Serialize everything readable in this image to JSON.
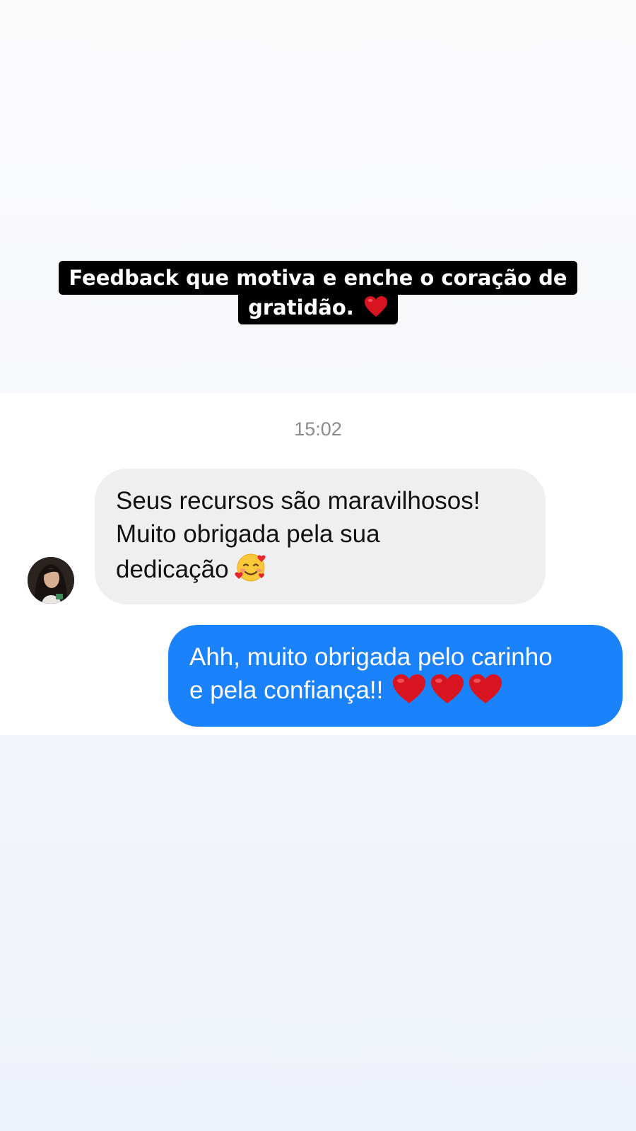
{
  "story": {
    "caption_line1": "Feedback que motiva e enche o coração de",
    "caption_line2": "gratidão.",
    "caption_emoji": "red-heart"
  },
  "chat": {
    "timestamp": "15:02",
    "incoming": {
      "line1": "Seus recursos são maravilhosos!",
      "line2": "Muito obrigada pela sua",
      "line3": "dedicação",
      "emoji": "smiling-face-with-hearts"
    },
    "outgoing": {
      "line1": "Ahh, muito obrigada pelo carinho",
      "line2": "e pela confiança!!",
      "emoji": "red-heart",
      "emoji_count": 3
    }
  },
  "colors": {
    "incoming_bubble": "#efeff0",
    "outgoing_bubble": "#1a82fb",
    "caption_background": "#000000",
    "heart": "#e0121e"
  }
}
